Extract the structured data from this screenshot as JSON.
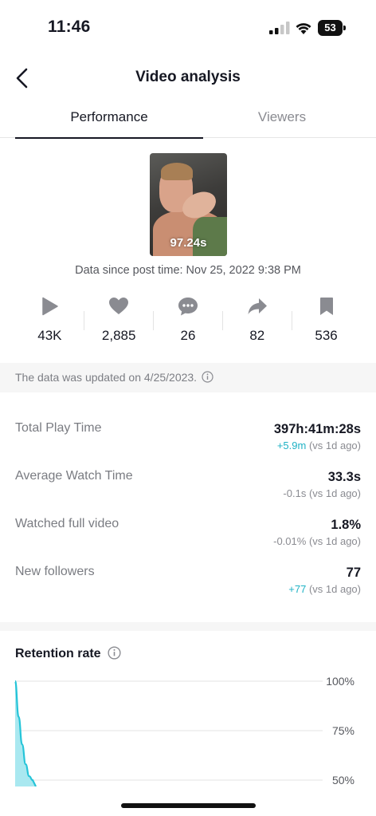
{
  "status_bar": {
    "time": "11:46",
    "battery": "53",
    "icons": [
      "signal-icon",
      "wifi-icon",
      "battery-icon"
    ]
  },
  "nav": {
    "title": "Video analysis",
    "back_icon": "chevron-left-icon"
  },
  "tabs": [
    {
      "label": "Performance",
      "active": true
    },
    {
      "label": "Viewers",
      "active": false
    }
  ],
  "video": {
    "duration": "97.24s",
    "post_info": "Data since post time: Nov 25, 2022 9:38 PM"
  },
  "stats": [
    {
      "icon": "play-icon",
      "value": "43K"
    },
    {
      "icon": "heart-icon",
      "value": "2,885"
    },
    {
      "icon": "comment-icon",
      "value": "26"
    },
    {
      "icon": "share-icon",
      "value": "82"
    },
    {
      "icon": "bookmark-icon",
      "value": "536"
    }
  ],
  "update_notice": "The data was updated on 4/25/2023.",
  "metrics": [
    {
      "label": "Total Play Time",
      "value": "397h:41m:28s",
      "delta": "+5.9m",
      "delta_suffix": "(vs 1d ago)",
      "delta_positive": true
    },
    {
      "label": "Average Watch Time",
      "value": "33.3s",
      "delta": "-0.1s",
      "delta_suffix": "(vs 1d ago)",
      "delta_positive": false
    },
    {
      "label": "Watched full video",
      "value": "1.8%",
      "delta": "-0.01%",
      "delta_suffix": "(vs 1d ago)",
      "delta_positive": false
    },
    {
      "label": "New followers",
      "value": "77",
      "delta": "+77",
      "delta_suffix": "(vs 1d ago)",
      "delta_positive": true
    }
  ],
  "retention": {
    "title": "Retention rate"
  },
  "chart_data": {
    "type": "area",
    "title": "Retention rate",
    "y_tick_labels": [
      "100%",
      "75%",
      "50%"
    ],
    "ylim": [
      50,
      100
    ],
    "grid": true,
    "series": [
      {
        "x": [
          0,
          1,
          2,
          3,
          4,
          5
        ],
        "values": [
          100,
          82,
          68,
          58,
          52,
          50
        ]
      }
    ],
    "colors": {
      "line": "#25c4d8",
      "fill": "#a9e8f0"
    }
  },
  "colors": {
    "accent": "#1fb2c5",
    "text_primary": "#161823",
    "text_secondary": "#7a7c82"
  }
}
